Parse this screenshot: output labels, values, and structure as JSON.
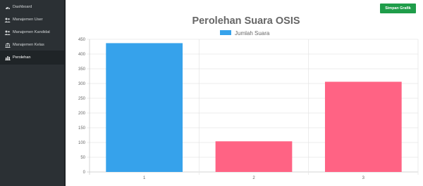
{
  "sidebar": {
    "items": [
      {
        "label": "Dashboard",
        "icon": "dashboard-icon",
        "active": false
      },
      {
        "label": "Manajemen User",
        "icon": "users-icon",
        "active": false
      },
      {
        "label": "Manajemen Kandidat",
        "icon": "users-icon",
        "active": false
      },
      {
        "label": "Manajemen Kelas",
        "icon": "bank-icon",
        "active": false
      },
      {
        "label": "Perolehan",
        "icon": "bar-chart-icon",
        "active": true
      }
    ]
  },
  "toolbar": {
    "save_label": "Simpan Grafik"
  },
  "colors": {
    "bar_blue": "#36a2eb",
    "bar_pink": "#ff6384",
    "save_button": "#1f9d4a"
  },
  "chart_data": {
    "type": "bar",
    "title": "Perolehan Suara OSIS",
    "legend": {
      "label": "Jumlah Suara",
      "placement": "top"
    },
    "categories": [
      "1",
      "2",
      "3"
    ],
    "series": [
      {
        "name": "Jumlah Suara",
        "values": [
          437,
          104,
          306
        ],
        "colors": [
          "#36a2eb",
          "#ff6384",
          "#ff6384"
        ]
      }
    ],
    "ylim": [
      0,
      450
    ],
    "yticks": [
      0,
      50,
      100,
      150,
      200,
      250,
      300,
      350,
      400,
      450
    ],
    "grid": true
  }
}
